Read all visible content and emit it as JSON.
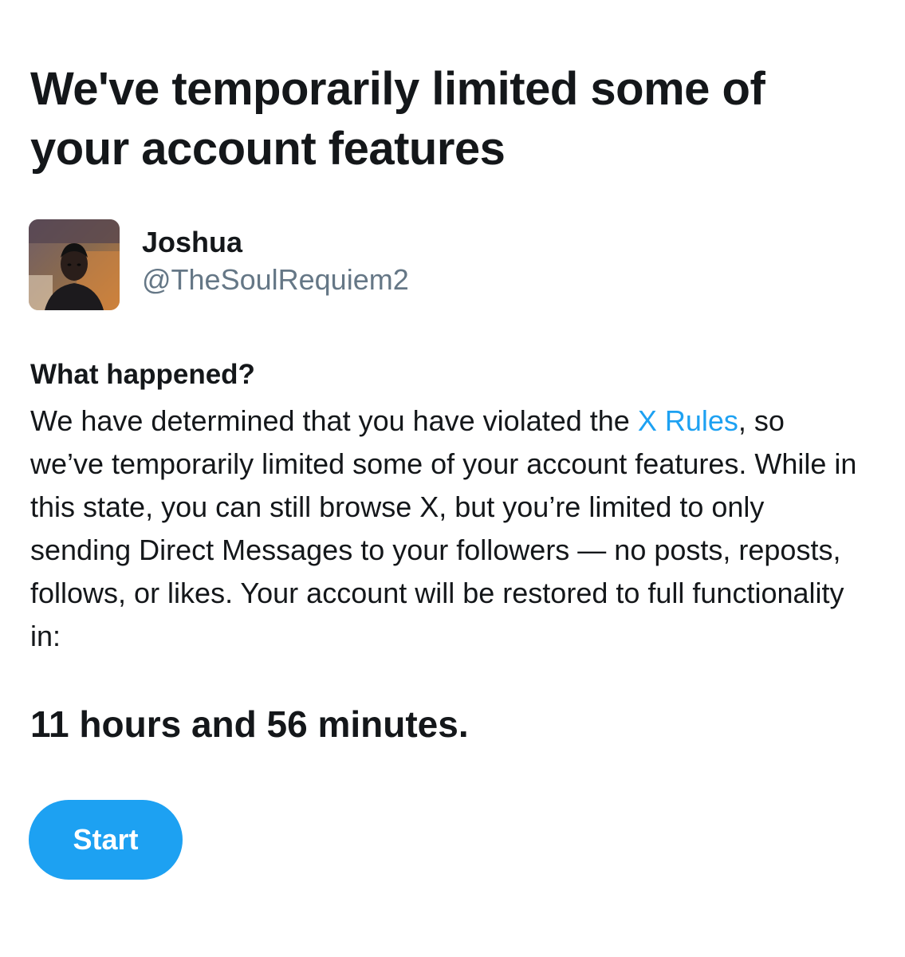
{
  "header": {
    "title": "We've temporarily limited some of your account features"
  },
  "profile": {
    "display_name": "Joshua",
    "handle": "@TheSoulRequiem2",
    "avatar_icon": "user-avatar-photo"
  },
  "notice": {
    "heading": "What happened?",
    "text_before_link": "We have determined that you have violated the ",
    "link_label": "X Rules",
    "text_after_link": ", so we’ve temporarily limited some of your account features. While in this state, you can still browse X, but you’re limited to only sending Direct Messages to your followers — no posts, reposts, follows, or likes. Your account will be restored to full functionality in:"
  },
  "countdown": {
    "text": "11 hours and 56 minutes."
  },
  "actions": {
    "start_label": "Start"
  },
  "colors": {
    "accent": "#1da1f2",
    "text_primary": "#14171a",
    "text_secondary": "#657786",
    "background": "#ffffff"
  }
}
